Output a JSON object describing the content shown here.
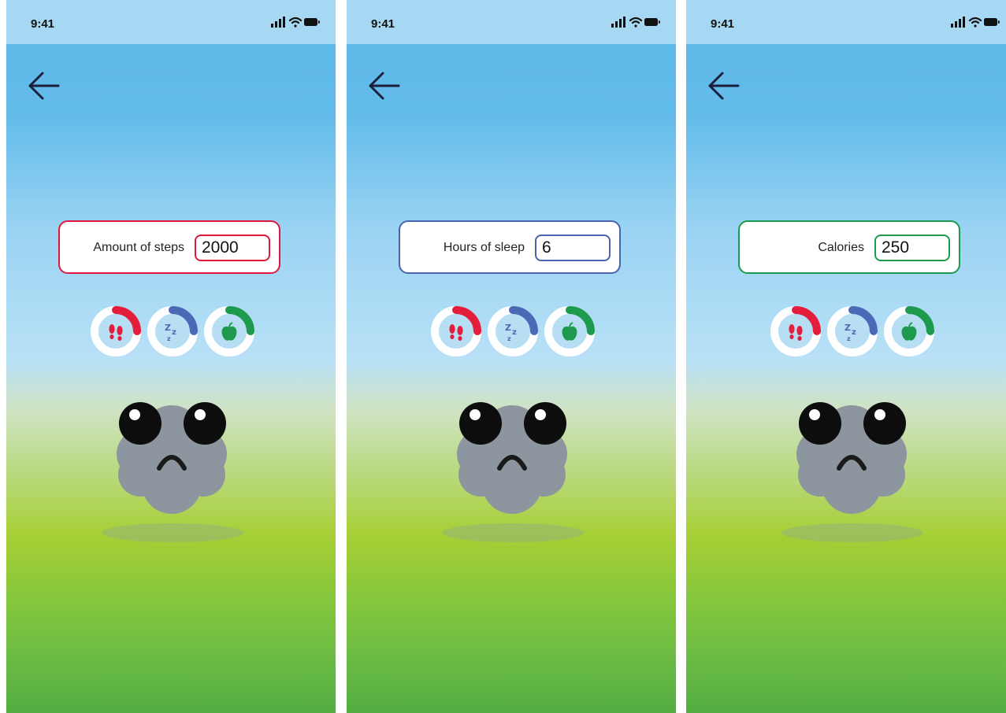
{
  "screens": [
    {
      "status": {
        "time": "9:41"
      },
      "field": {
        "label": "Amount of steps",
        "value": "2000",
        "accent": "#e0173d"
      },
      "metrics": [
        {
          "name": "steps",
          "icon": "footprints-icon",
          "color": "#e41d3c",
          "progress": 0.25
        },
        {
          "name": "sleep",
          "icon": "sleep-zzz-icon",
          "color": "#4a6ab8",
          "progress": 0.25
        },
        {
          "name": "calories",
          "icon": "apple-icon",
          "color": "#1d9a4d",
          "progress": 0.25
        }
      ],
      "mascot": {
        "mood": "sad"
      }
    },
    {
      "status": {
        "time": "9:41"
      },
      "field": {
        "label": "Hours of sleep",
        "value": "6",
        "accent": "#4a63b0"
      },
      "metrics": [
        {
          "name": "steps",
          "icon": "footprints-icon",
          "color": "#e41d3c",
          "progress": 0.25
        },
        {
          "name": "sleep",
          "icon": "sleep-zzz-icon",
          "color": "#4a6ab8",
          "progress": 0.25
        },
        {
          "name": "calories",
          "icon": "apple-icon",
          "color": "#1d9a4d",
          "progress": 0.25
        }
      ],
      "mascot": {
        "mood": "sad"
      }
    },
    {
      "status": {
        "time": "9:41"
      },
      "field": {
        "label": "Calories",
        "value": "250",
        "accent": "#1d9a4d"
      },
      "metrics": [
        {
          "name": "steps",
          "icon": "footprints-icon",
          "color": "#e41d3c",
          "progress": 0.25
        },
        {
          "name": "sleep",
          "icon": "sleep-zzz-icon",
          "color": "#4a6ab8",
          "progress": 0.25
        },
        {
          "name": "calories",
          "icon": "apple-icon",
          "color": "#1d9a4d",
          "progress": 0.25
        }
      ],
      "mascot": {
        "mood": "sad"
      }
    }
  ]
}
